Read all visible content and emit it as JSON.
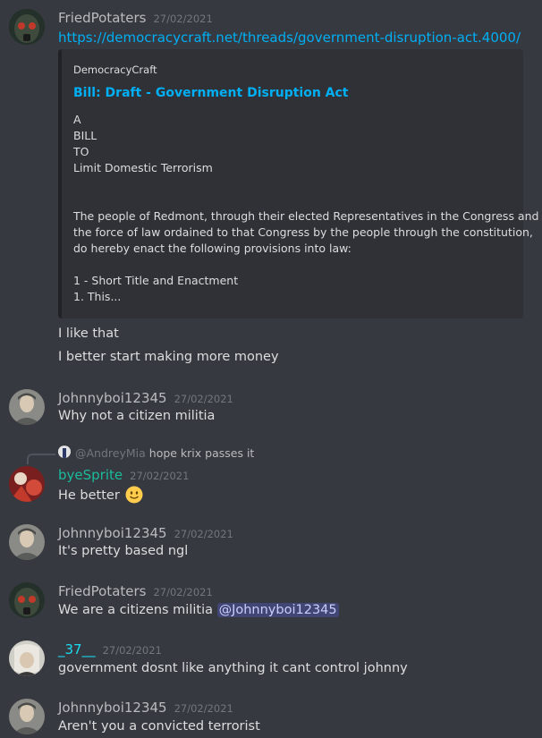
{
  "messages": [
    {
      "username": "FriedPotaters",
      "timestamp": "27/02/2021",
      "link": "https://democracycraft.net/threads/government-disruption-act.4000/",
      "embed": {
        "provider": "DemocracyCraft",
        "title": "Bill: Draft - Government Disruption Act",
        "lines": [
          "A",
          "BILL",
          "TO",
          "Limit Domestic Terrorism",
          "The people of Redmont, through their elected Representatives in the Congress and",
          "the force of law ordained to that Congress by the people through the constitution,",
          "do hereby enact the following provisions into law:",
          "1 - Short Title and Enactment",
          "1. This..."
        ]
      },
      "followups": [
        "I like that",
        "I better start making more money"
      ]
    },
    {
      "username": "Johnnyboi12345",
      "timestamp": "27/02/2021",
      "text": "Why not a citizen militia"
    },
    {
      "reply": {
        "mention": "@AndreyMia",
        "text": "hope krix passes it"
      },
      "username": "byeSprite",
      "timestamp": "27/02/2021",
      "text": "He better",
      "emoji": "slightly-smiling-face"
    },
    {
      "username": "Johnnyboi12345",
      "timestamp": "27/02/2021",
      "text": "It's pretty based ngl"
    },
    {
      "username": "FriedPotaters",
      "timestamp": "27/02/2021",
      "text": "We are a citizens militia",
      "mention": "@Johnnyboi12345"
    },
    {
      "username": "_37__",
      "timestamp": "27/02/2021",
      "text": "government dosnt like anything it cant control johnny"
    },
    {
      "username": "Johnnyboi12345",
      "timestamp": "27/02/2021",
      "text": "Aren't you a convicted terrorist"
    }
  ],
  "colors": {
    "background": "#36393f",
    "embed_bg": "#2f3136",
    "link": "#00aff4",
    "username_default": "#b9bbbe",
    "username_byesprite": "#1abc9c",
    "username_37": "#1bdcf0",
    "mention_bg": "#414675"
  }
}
